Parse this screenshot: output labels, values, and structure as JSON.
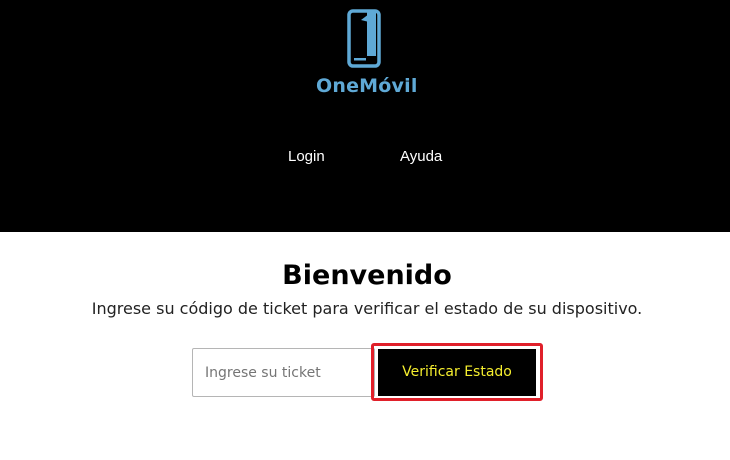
{
  "header": {
    "logo": {
      "icon": "phone-one-logo-icon",
      "text": "OneMóvil",
      "color": "#5fa9d6"
    },
    "nav": [
      {
        "label": "Login"
      },
      {
        "label": "Ayuda"
      }
    ],
    "background": "#000000"
  },
  "main": {
    "title": "Bienvenido",
    "subtitle": "Ingrese su código de ticket para verificar el estado de su dispositivo.",
    "ticket_input": {
      "value": "",
      "placeholder": "Ingrese su ticket"
    },
    "verify_button": {
      "label": "Verificar Estado",
      "text_color": "#f5ee2e",
      "background": "#000000",
      "highlight_color": "#e0202a"
    }
  }
}
